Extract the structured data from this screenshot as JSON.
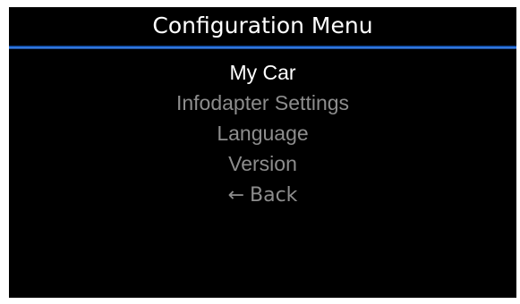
{
  "screen": {
    "title": "Configuration Menu",
    "accent_color": "#1f6fe0",
    "background_color": "#000000"
  },
  "menu": {
    "selected_index": 0,
    "items": [
      {
        "label": "My Car"
      },
      {
        "label": "Infodapter Settings"
      },
      {
        "label": "Language"
      },
      {
        "label": "Version"
      }
    ],
    "back": {
      "icon": "left-arrow-icon",
      "glyph": "←",
      "label": "Back"
    }
  }
}
